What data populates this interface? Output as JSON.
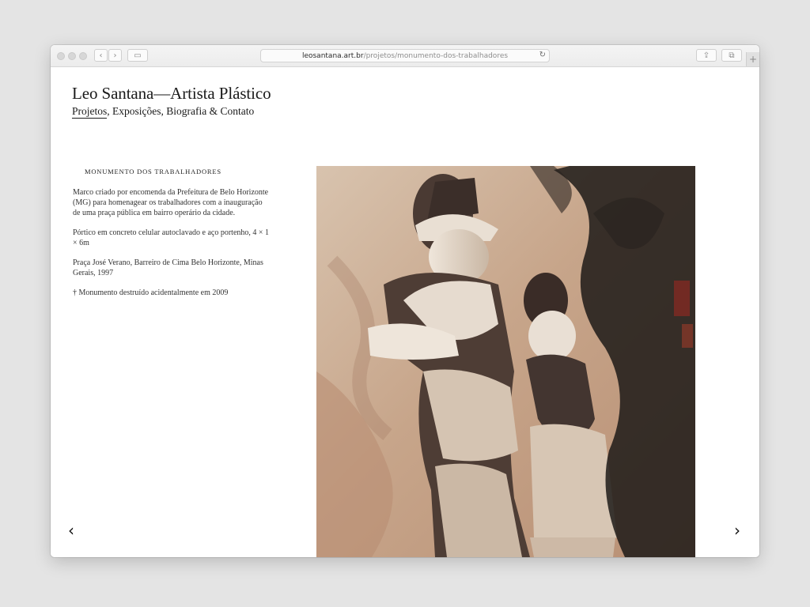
{
  "browser": {
    "address_host": "leosantana.art.br",
    "address_path": "/projetos/monumento-dos-trabalhadores",
    "buttons": {
      "back": "‹",
      "forward": "›",
      "sidebar": "▭",
      "reload": "↻",
      "share": "⇪",
      "tabs": "⧉",
      "new_tab": "+"
    }
  },
  "site": {
    "title": "Leo Santana—Artista Plástico",
    "nav": [
      {
        "label": "Projetos",
        "active": true
      },
      {
        "label": "Exposições"
      },
      {
        "label": "Biografia"
      },
      {
        "label": "Contato"
      }
    ],
    "nav_separators": [
      ", ",
      ", ",
      " & "
    ]
  },
  "project": {
    "title": "Monumento dos Trabalhadores",
    "paragraphs": [
      "Marco criado por encomenda da Prefeitura de Belo Horizonte (MG) para homenagear os trabalhadores com a inauguração de uma praça pública em bairro operário da cidade.",
      "Pórtico em concreto celular autoclavado e aço portenho, 4 × 1 × 6m",
      "Praça José Verano, Barreiro de Cima Belo Horizonte, Minas Gerais, 1997",
      "† Monumento destruído acidentalmente em 2009"
    ]
  },
  "navigation": {
    "prev_symbol": "‹",
    "next_symbol": "›"
  },
  "colors": {
    "window_bg": "#ffffff",
    "page_bg": "#e4e4e4",
    "text": "#1a1a1a"
  }
}
